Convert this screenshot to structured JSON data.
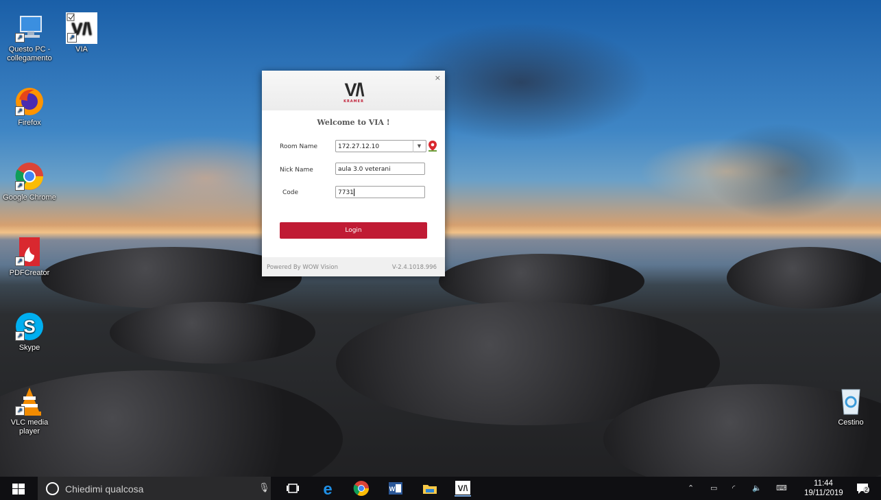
{
  "desktop": {
    "icons": [
      {
        "label": "Questo PC - collegamento",
        "icon": "computer-icon"
      },
      {
        "label": "VIA",
        "icon": "via-icon"
      },
      {
        "label": "Firefox",
        "icon": "firefox-icon"
      },
      {
        "label": "Google Chrome",
        "icon": "chrome-icon"
      },
      {
        "label": "PDFCreator",
        "icon": "pdfcreator-icon"
      },
      {
        "label": "Skype",
        "icon": "skype-icon"
      },
      {
        "label": "VLC media player",
        "icon": "vlc-icon"
      },
      {
        "label": "Cestino",
        "icon": "recycle-bin-icon"
      }
    ]
  },
  "dialog": {
    "logo_main": "V/\\",
    "logo_sub": "KRAMER",
    "close_label": "×",
    "welcome": "Welcome to VIA !",
    "room_label": "Room Name",
    "room_value": "172.27.12.10",
    "nick_label": "Nick Name",
    "nick_value": "aula 3.0 veterani",
    "code_label": "Code",
    "code_value": "7731",
    "login_label": "Login",
    "powered_by": "Powered By WOW Vision",
    "version": "V-2.4.1018.996",
    "accent": "#c01b34"
  },
  "taskbar": {
    "search_placeholder": "Chiedimi qualcosa",
    "apps": [
      "task-view-icon",
      "edge-icon",
      "chrome-icon",
      "word-icon",
      "file-explorer-icon",
      "via-icon"
    ],
    "time": "11:44",
    "date": "19/11/2019",
    "notifications": "2"
  }
}
